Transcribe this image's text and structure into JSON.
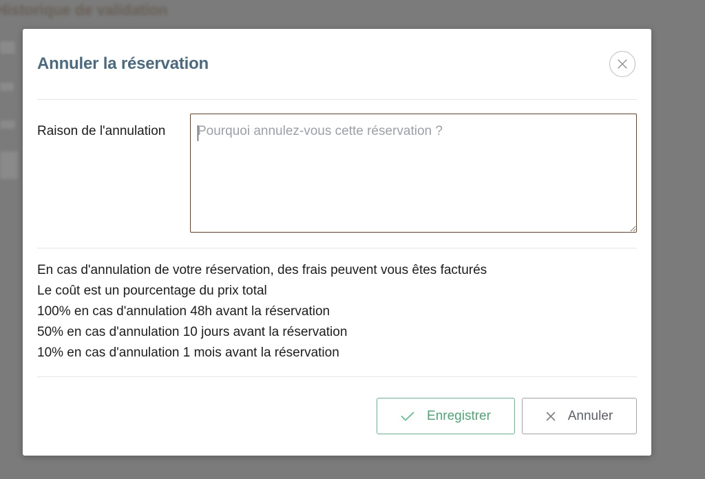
{
  "background": {
    "title": "Historique de validation"
  },
  "modal": {
    "title": "Annuler la réservation",
    "close_icon": "close-icon",
    "reason": {
      "label": "Raison de l'annulation",
      "value": "",
      "placeholder": "Pourquoi annulez-vous cette réservation ?"
    },
    "info_lines": [
      "En cas d'annulation de votre réservation, des frais peuvent vous êtes facturés",
      "Le coût est un pourcentage du prix total",
      "100% en cas d'annulation 48h avant la réservation",
      "50% en cas d'annulation 10 jours avant la réservation",
      "10% en cas d'annulation 1 mois avant la réservation"
    ],
    "buttons": {
      "save_label": "Enregistrer",
      "save_icon": "check-icon",
      "cancel_label": "Annuler",
      "cancel_icon": "x-icon"
    }
  },
  "colors": {
    "title": "#4a6a80",
    "save_accent": "#4aa874",
    "textarea_border": "#7a3d1a",
    "overlay": "#7b7b7b"
  }
}
